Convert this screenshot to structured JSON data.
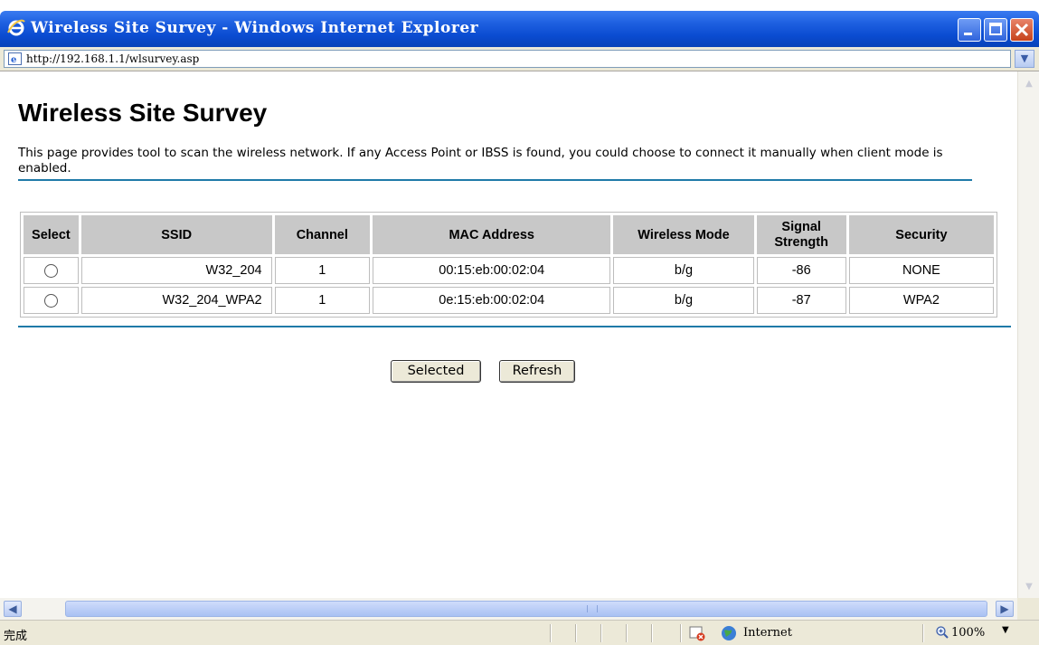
{
  "window": {
    "title": "Wireless Site Survey - Windows Internet Explorer",
    "address": "http://192.168.1.1/wlsurvey.asp"
  },
  "page": {
    "title": "Wireless Site Survey",
    "description": "This page provides tool to scan the wireless network. If any Access Point or IBSS is found, you could choose to connect it manually when client mode is enabled."
  },
  "table": {
    "headers": {
      "select": "Select",
      "ssid": "SSID",
      "channel": "Channel",
      "mac": "MAC Address",
      "mode": "Wireless Mode",
      "signal_line1": "Signal",
      "signal_line2": "Strength",
      "security": "Security"
    },
    "rows": [
      {
        "ssid": "W32_204",
        "channel": "1",
        "mac": "00:15:eb:00:02:04",
        "mode": "b/g",
        "signal": "-86",
        "security": "NONE"
      },
      {
        "ssid": "W32_204_WPA2",
        "channel": "1",
        "mac": "0e:15:eb:00:02:04",
        "mode": "b/g",
        "signal": "-87",
        "security": "WPA2"
      }
    ]
  },
  "buttons": {
    "selected": "Selected",
    "refresh": "Refresh"
  },
  "statusbar": {
    "status": "完成",
    "zone": "Internet",
    "zoom": "100%"
  },
  "colors": {
    "titlebar": "#0a4bd0",
    "rule": "#1f7aa8",
    "header_bg": "#c8c8c8"
  }
}
